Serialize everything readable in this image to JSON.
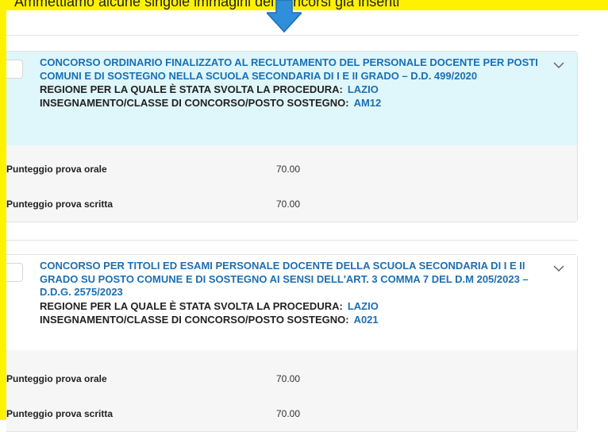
{
  "caption": "Ammettiamo alcune singole immagini dei concorsi già inseriti",
  "cards": [
    {
      "title": "CONCORSO ORDINARIO FINALIZZATO AL RECLUTAMENTO DEL PERSONALE DOCENTE PER POSTI COMUNI E DI SOSTEGNO NELLA SCUOLA SECONDARIA DI I E II GRADO – D.D. 499/2020",
      "region_label": "REGIONE PER LA QUALE È STATA SVOLTA LA PROCEDURA:",
      "region_value": "LAZIO",
      "class_label": "INSEGNAMENTO/CLASSE DI CONCORSO/POSTO SOSTEGNO:",
      "class_value": "AM12",
      "rows": [
        {
          "label": "Punteggio prova orale",
          "value": "70.00"
        },
        {
          "label": "Punteggio prova scritta",
          "value": "70.00"
        }
      ]
    },
    {
      "title": "CONCORSO PER TITOLI ED ESAMI PERSONALE DOCENTE DELLA SCUOLA SECONDARIA DI I E II GRADO SU POSTO COMUNE E DI SOSTEGNO AI SENSI DELL'ART. 3 COMMA 7 DEL D.M 205/2023 – D.D.G. 2575/2023",
      "region_label": "REGIONE PER LA QUALE È STATA SVOLTA LA PROCEDURA:",
      "region_value": "LAZIO",
      "class_label": "INSEGNAMENTO/CLASSE DI CONCORSO/POSTO SOSTEGNO:",
      "class_value": "A021",
      "rows": [
        {
          "label": "Punteggio prova orale",
          "value": "70.00"
        },
        {
          "label": "Punteggio prova scritta",
          "value": "70.00"
        }
      ]
    }
  ],
  "colors": {
    "highlight": "#fff200",
    "accent": "#1b6fb3",
    "head_bg": "#dff6fb",
    "arrow": "#2f8fd8"
  },
  "icons": {
    "arrow": "arrow-down-icon",
    "expand": "chevron-down-icon"
  }
}
